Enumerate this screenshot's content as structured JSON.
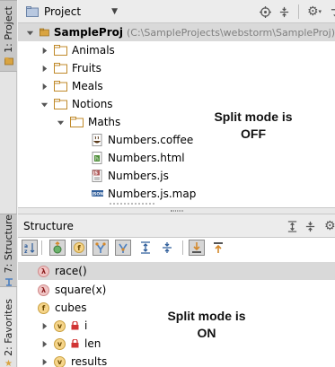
{
  "tool_strip": {
    "project_tab": "1: Project",
    "structure_tab": "7: Structure",
    "favorites_tab": "2: Favorites"
  },
  "project_panel": {
    "title": "Project",
    "root": {
      "name": "SampleProj",
      "path": "(C:\\SampleProjects\\webstorm\\SampleProj)"
    },
    "folders": [
      "Animals",
      "Fruits",
      "Meals",
      "Notions",
      "Maths"
    ],
    "files": [
      "Numbers.coffee",
      "Numbers.html",
      "Numbers.js",
      "Numbers.js.map"
    ],
    "note_line1": "Split mode is",
    "note_line2": "OFF"
  },
  "structure_panel": {
    "title": "Structure",
    "items": [
      "race()",
      "square(x)",
      "cubes",
      "i",
      "len",
      "results"
    ],
    "note_line1": "Split mode is",
    "note_line2": "ON"
  },
  "colors": {
    "selection": "#d9d9d9",
    "folder": "#d9a441",
    "path_text": "#808080"
  }
}
